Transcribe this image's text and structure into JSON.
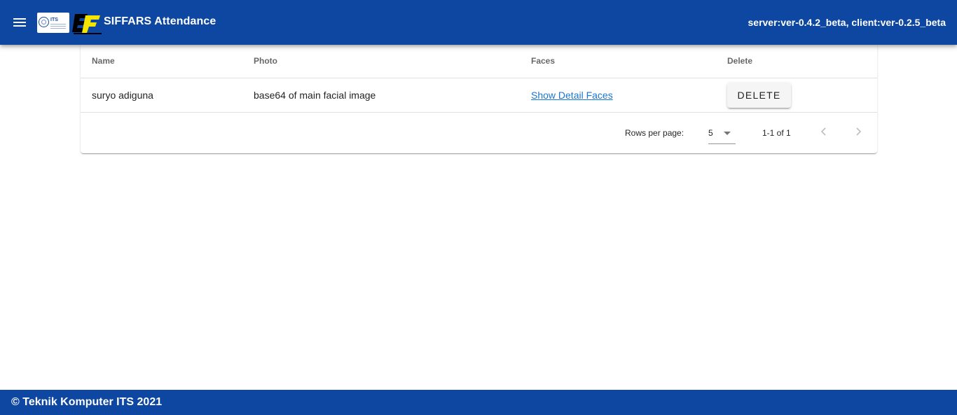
{
  "app_bar": {
    "title": "SIFFARS Attendance",
    "version": "server:ver-0.4.2_beta, client:ver-0.2.5_beta",
    "its_logo_text": "ITS",
    "color": "#0d47a1"
  },
  "table": {
    "headers": [
      "Name",
      "Photo",
      "Faces",
      "Delete"
    ],
    "rows": [
      {
        "name": "suryo adiguna",
        "photo": "base64 of main facial image",
        "faces_link": "Show Detail Faces",
        "delete_label": "DELETE"
      }
    ]
  },
  "pagination": {
    "rows_per_page_label": "Rows per page:",
    "rows_per_page_value": "5",
    "range": "1-1 of 1"
  },
  "footer": {
    "text": "© Teknik Komputer ITS 2021"
  },
  "colors": {
    "primary": "#0d47a1",
    "link": "#1976d2",
    "logo_yellow": "#f5e400"
  }
}
